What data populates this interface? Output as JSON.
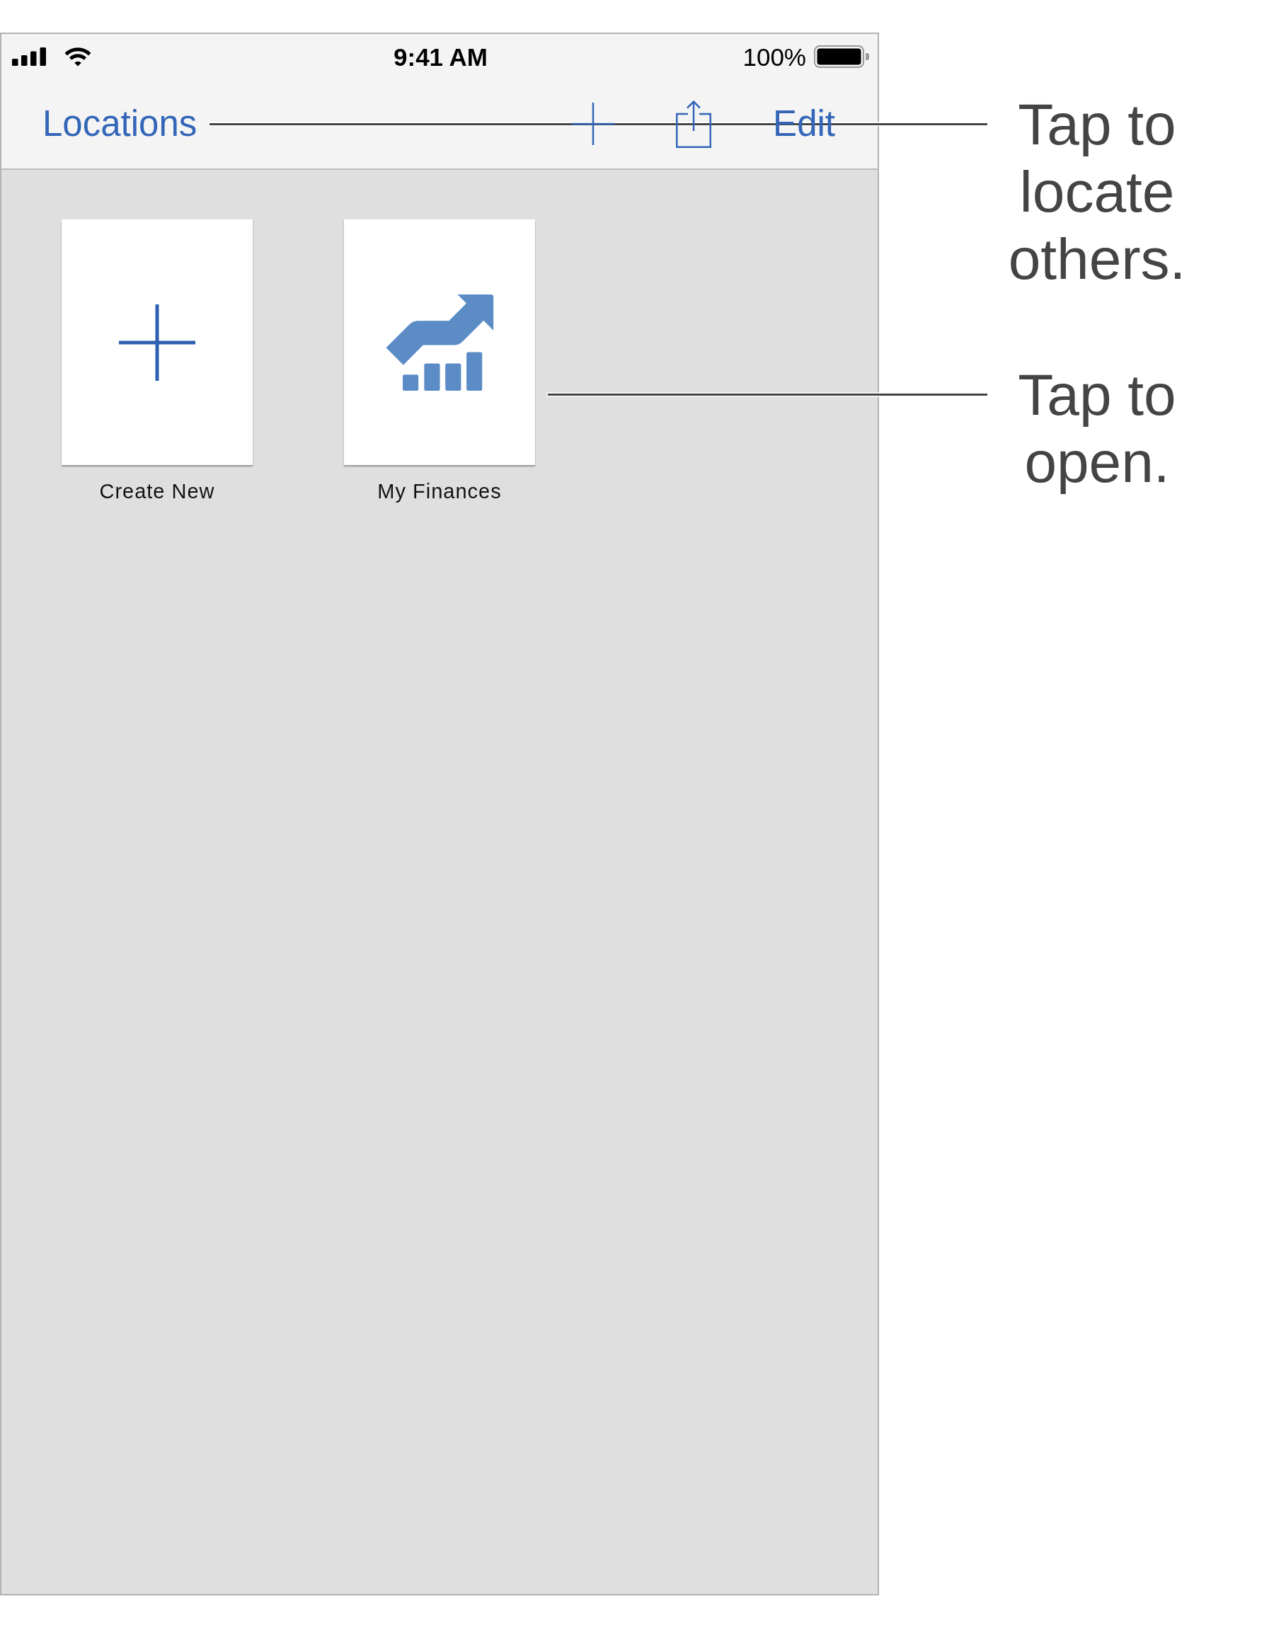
{
  "status_bar": {
    "time": "9:41 AM",
    "battery": "100%"
  },
  "nav_bar": {
    "back_button": {
      "label": "Locations",
      "callout": "Tap to locate others."
    },
    "edit_button": {
      "label": "Edit"
    }
  },
  "documents": [
    {
      "kind": "new",
      "title": "Create New"
    },
    {
      "kind": "file",
      "title": "My Finances",
      "callout": "Tap to open."
    }
  ]
}
